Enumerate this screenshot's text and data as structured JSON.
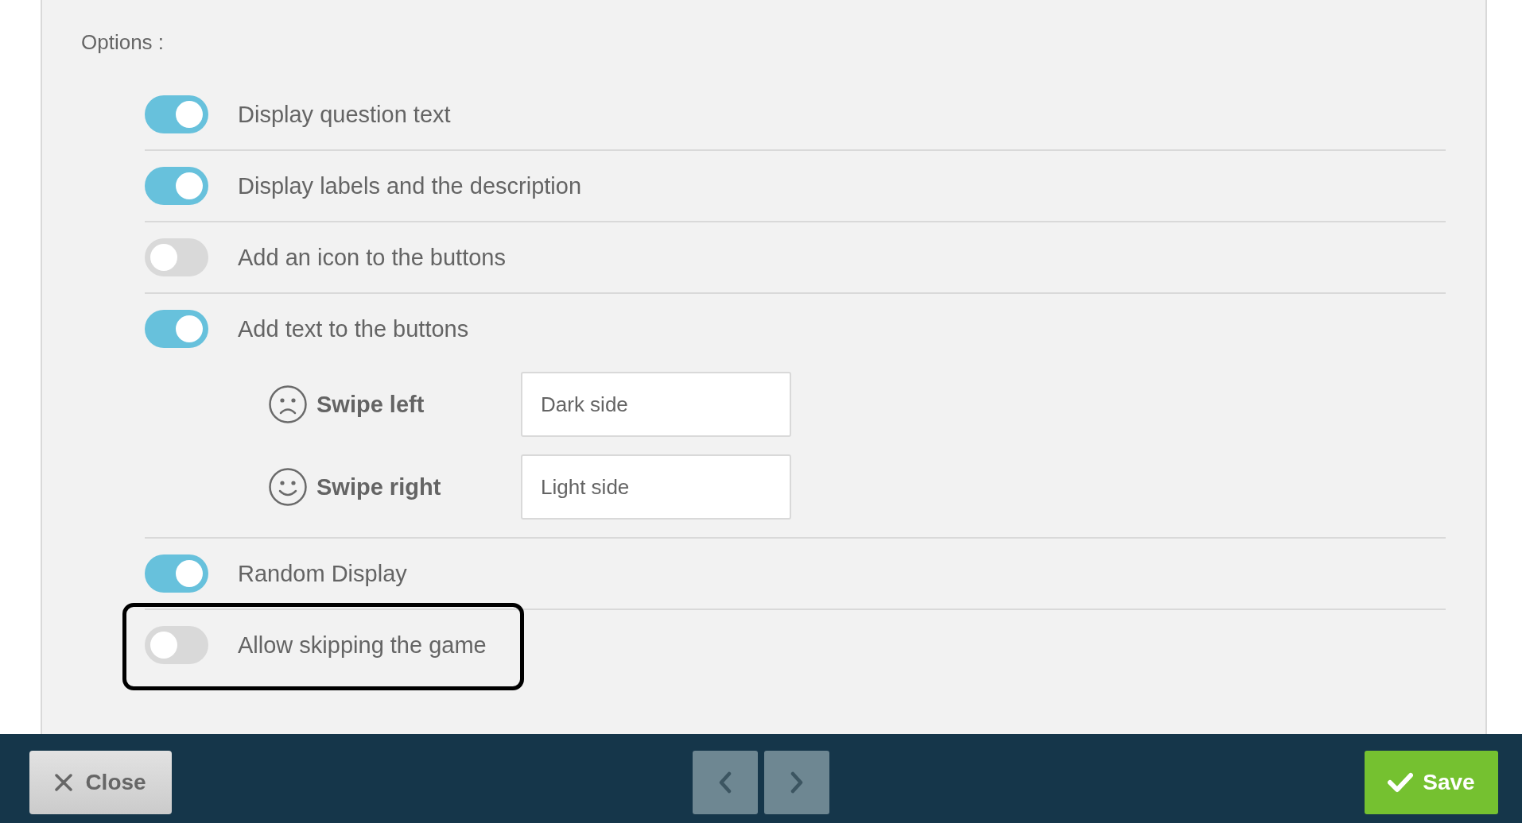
{
  "options_label": "Options :",
  "options": [
    {
      "label": "Display question text",
      "on": true,
      "highlighted": false
    },
    {
      "label": "Display labels and the description",
      "on": true,
      "highlighted": false
    },
    {
      "label": "Add an icon to the buttons",
      "on": false,
      "highlighted": false
    },
    {
      "label": "Add text to the buttons",
      "on": true,
      "highlighted": false,
      "button_texts": [
        {
          "kind": "sad",
          "label": "Swipe left",
          "value": "Dark side"
        },
        {
          "kind": "happy",
          "label": "Swipe right",
          "value": "Light side"
        }
      ]
    },
    {
      "label": "Random Display",
      "on": true,
      "highlighted": false
    },
    {
      "label": "Allow skipping the game",
      "on": false,
      "highlighted": true
    }
  ],
  "footer": {
    "close_button": "Close",
    "save_button": "Save"
  }
}
